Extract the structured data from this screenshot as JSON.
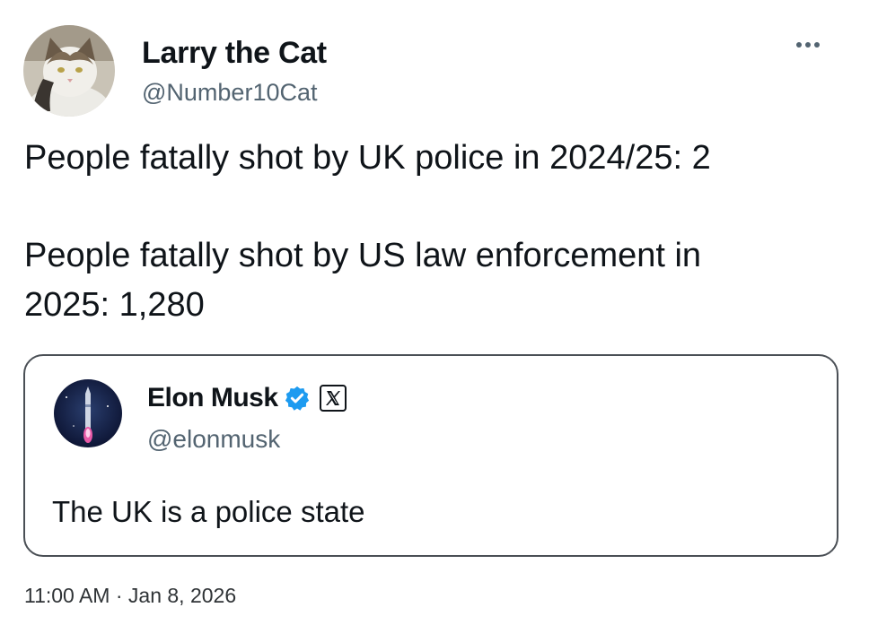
{
  "tweet": {
    "author": {
      "name": "Larry the Cat",
      "handle": "@Number10Cat"
    },
    "more_icon": "more-horizontal-icon",
    "text_lines": [
      "People fatally shot by UK police in 2024/25: 2",
      "People fatally shot by US law enforcement in",
      "2025: 1,280"
    ],
    "quoted": {
      "name": "Elon Musk",
      "handle": "@elonmusk",
      "verified_icon": "verified-badge-icon",
      "affiliation_icon": "x-logo-icon",
      "text": "The UK is a police state"
    },
    "timestamp": "11:00 AM · Jan 8, 2026"
  },
  "colors": {
    "text": "#0f1419",
    "secondary": "#536471",
    "verified": "#1d9bf0",
    "card_border": "#4a4f55"
  }
}
